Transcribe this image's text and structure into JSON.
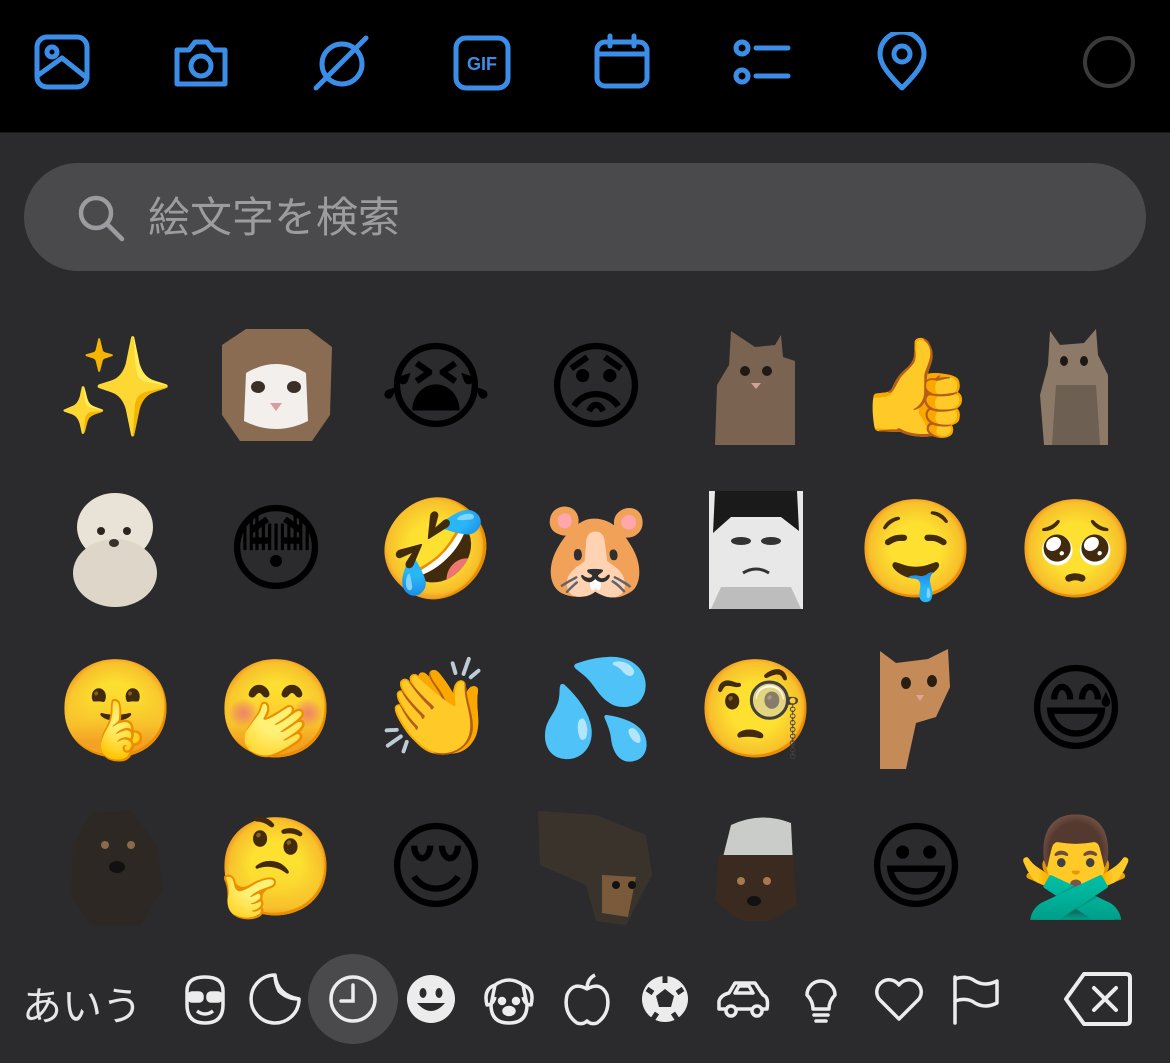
{
  "toolbar": {
    "items": [
      {
        "name": "image-icon"
      },
      {
        "name": "camera-icon"
      },
      {
        "name": "no-entry-icon"
      },
      {
        "name": "gif-icon",
        "label": "GIF"
      },
      {
        "name": "calendar-icon"
      },
      {
        "name": "list-icon"
      },
      {
        "name": "location-pin-icon"
      },
      {
        "name": "progress-circle-icon"
      }
    ],
    "accent_color": "#3b8ee8"
  },
  "search": {
    "placeholder": "絵文字を検索",
    "value": ""
  },
  "grid": {
    "rows": [
      [
        "✨",
        "cat-sticker",
        "😭",
        "😟",
        "cat-sticker",
        "👍",
        "cat-sticker"
      ],
      [
        "dog-sticker",
        "😳",
        "🤣",
        "🐹",
        "manga-sticker",
        "🤤",
        "🥺"
      ],
      [
        "🤫",
        "🤭",
        "👏",
        "💦",
        "🧐",
        "cat-sticker",
        "😅"
      ],
      [
        "dog-sticker",
        "🤔",
        "😌",
        "dog-sticker",
        "dog-sticker",
        "😃",
        "🙅‍♂️"
      ]
    ]
  },
  "categories": {
    "kana_label": "あいう",
    "items": [
      {
        "name": "memoji-icon"
      },
      {
        "name": "sticker-icon"
      },
      {
        "name": "recent-clock-icon",
        "selected": true
      },
      {
        "name": "smiley-icon"
      },
      {
        "name": "animal-icon"
      },
      {
        "name": "food-apple-icon"
      },
      {
        "name": "activity-ball-icon"
      },
      {
        "name": "travel-car-icon"
      },
      {
        "name": "objects-bulb-icon"
      },
      {
        "name": "symbols-heart-icon"
      },
      {
        "name": "flags-icon"
      }
    ],
    "backspace": "delete-backward-icon"
  }
}
